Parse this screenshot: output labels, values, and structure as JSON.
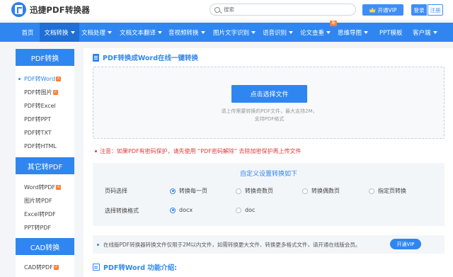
{
  "header": {
    "logo_text": "迅捷PDF转换器",
    "search_placeholder": "搜索",
    "vip_label": "开通VIP",
    "login_label": "登录",
    "register_label": "注册"
  },
  "nav": {
    "items": [
      {
        "label": "首页"
      },
      {
        "label": "文档转换"
      },
      {
        "label": "文档处理"
      },
      {
        "label": "文档文本翻译"
      },
      {
        "label": "音视频转换"
      },
      {
        "label": "图片文字识别"
      },
      {
        "label": "语音识别"
      },
      {
        "label": "论文查重",
        "badge": "新"
      },
      {
        "label": "思维导图"
      },
      {
        "label": "PPT模板"
      },
      {
        "label": "客户端"
      }
    ]
  },
  "sidebar": {
    "sections": [
      {
        "title": "PDF转换",
        "items": [
          "PDF转Word",
          "PDF转图片",
          "PDF转Excel",
          "PDF转PPT",
          "PDF转TXT",
          "PDF转HTML"
        ]
      },
      {
        "title": "其它转PDF",
        "items": [
          "Word转PDF",
          "图片转PDF",
          "Excel转PDF",
          "PPT转PDF"
        ]
      },
      {
        "title": "CAD转换",
        "items": [
          "CAD转PDF"
        ]
      }
    ],
    "hot_mark": "火"
  },
  "main": {
    "title": "PDF转换成Word在线一键转换",
    "upload_button": "点击选择文件",
    "upload_hint_1": "请上传需要转换的PDF文件，最大支持2M，",
    "upload_hint_2": "支持PDF格式",
    "warning": "注意：如果PDF有密码保护，请先使用 “PDF密码解除” 去除加密保护再上传文件",
    "settings_title": "自定义设置转换如下",
    "page_label": "页码选择",
    "page_options": [
      "转换每一页",
      "转换奇数页",
      "转换偶数页",
      "指定页转换"
    ],
    "format_label": "选择转换格式",
    "format_options": [
      "docx",
      "doc"
    ],
    "notice": "在线版PDF转换器转换文件仅限于2M以内文件，如需转换更大文件、转换更多格式文件，请开通在线版会员。",
    "notice_button": "开通VIP",
    "intro_title": "PDF转Word 功能介绍:"
  }
}
